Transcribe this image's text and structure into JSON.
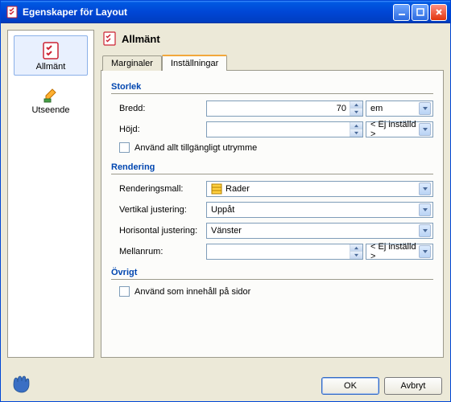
{
  "window": {
    "title": "Egenskaper för Layout"
  },
  "sidebar": {
    "items": [
      {
        "label": "Allmänt"
      },
      {
        "label": "Utseende"
      }
    ]
  },
  "main": {
    "header": "Allmänt",
    "tabs": [
      {
        "label": "Marginaler"
      },
      {
        "label": "Inställningar"
      }
    ]
  },
  "groups": {
    "storlek": {
      "title": "Storlek",
      "bredd_label": "Bredd:",
      "bredd_value": "70",
      "bredd_unit": "em",
      "hojd_label": "Höjd:",
      "hojd_value": "",
      "hojd_unit": "< Ej inställd >",
      "checkbox": "Använd allt tillgängligt utrymme"
    },
    "rendering": {
      "title": "Rendering",
      "mall_label": "Renderingsmall:",
      "mall_value": "Rader",
      "vjust_label": "Vertikal justering:",
      "vjust_value": "Uppåt",
      "hjust_label": "Horisontal justering:",
      "hjust_value": "Vänster",
      "mellan_label": "Mellanrum:",
      "mellan_value": "",
      "mellan_unit": "< Ej inställd >"
    },
    "ovrigt": {
      "title": "Övrigt",
      "checkbox": "Använd som innehåll på sidor"
    }
  },
  "buttons": {
    "ok": "OK",
    "cancel": "Avbryt"
  }
}
